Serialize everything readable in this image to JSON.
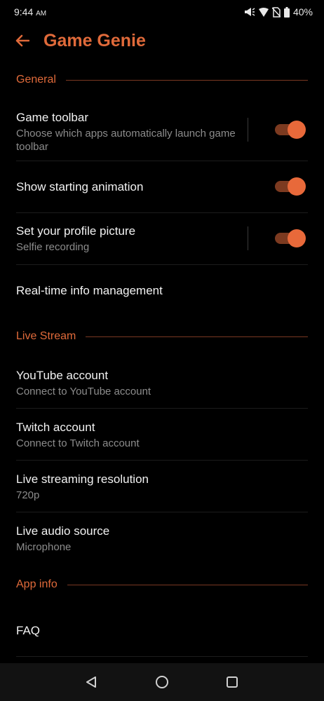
{
  "status": {
    "time": "9:44",
    "ampm": "AM",
    "battery": "40%"
  },
  "header": {
    "title": "Game Genie"
  },
  "sections": {
    "general": "General",
    "live_stream": "Live Stream",
    "app_info": "App info"
  },
  "general_items": [
    {
      "label": "Game toolbar",
      "sub": "Choose which apps automatically launch game toolbar",
      "toggle": true
    },
    {
      "label": "Show starting animation",
      "toggle": true
    },
    {
      "label": "Set your profile picture",
      "sub": "Selfie recording",
      "toggle": true
    },
    {
      "label": "Real-time info management"
    }
  ],
  "live_stream_items": [
    {
      "label": "YouTube account",
      "sub": "Connect to YouTube account"
    },
    {
      "label": "Twitch account",
      "sub": "Connect to Twitch account"
    },
    {
      "label": "Live streaming resolution",
      "sub": "720p"
    },
    {
      "label": "Live audio source",
      "sub": "Microphone"
    }
  ],
  "app_info_items": [
    {
      "label": "FAQ"
    }
  ],
  "colors": {
    "accent": "#e06a3a",
    "background": "#000000",
    "toggle_track": "#7c3a20",
    "toggle_thumb": "#e8693a"
  }
}
